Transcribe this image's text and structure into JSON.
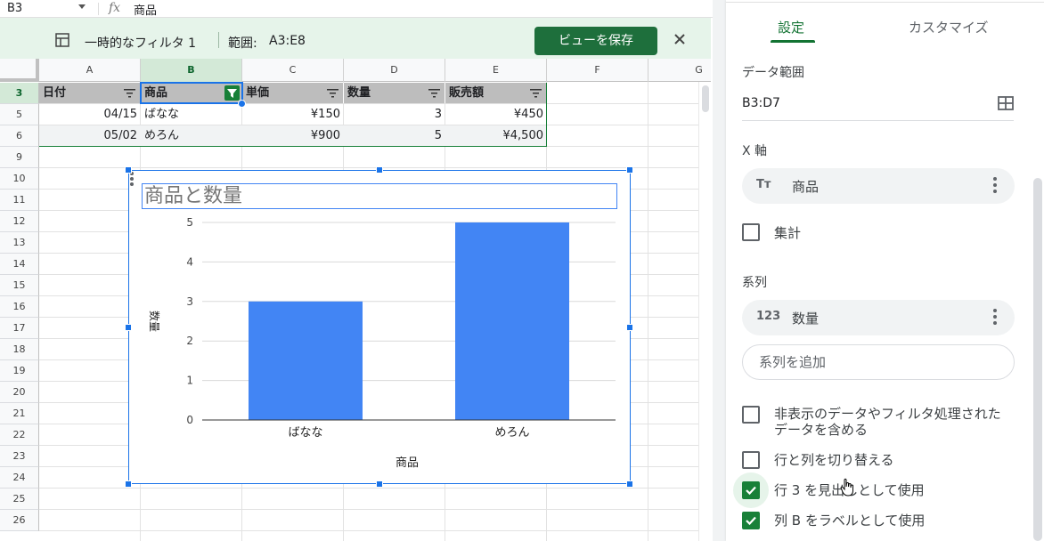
{
  "formula_bar": {
    "cell_ref": "B3",
    "fx": "fx",
    "formula": "商品"
  },
  "filter_view": {
    "name": "一時的なフィルタ 1",
    "range_label": "範囲:",
    "range": "A3:E8",
    "save_button": "ビューを保存"
  },
  "grid": {
    "columns": [
      "A",
      "B",
      "C",
      "D",
      "E",
      "F",
      "G"
    ],
    "rows": [
      "3",
      "5",
      "6",
      "9",
      "10",
      "11",
      "12",
      "13",
      "14",
      "15",
      "16",
      "17",
      "18",
      "19",
      "20",
      "21",
      "22",
      "23",
      "24",
      "25",
      "26"
    ],
    "header_row": [
      "日付",
      "商品",
      "単価",
      "数量",
      "販売額"
    ],
    "data_rows": [
      [
        "04/15",
        "ばなな",
        "¥150",
        "3",
        "¥450"
      ],
      [
        "05/02",
        "めろん",
        "¥900",
        "5",
        "¥4,500"
      ]
    ]
  },
  "chart_data": {
    "type": "bar",
    "title": "商品と数量",
    "categories": [
      "ばなな",
      "めろん"
    ],
    "values": [
      3,
      5
    ],
    "xlabel": "商品",
    "ylabel": "数量",
    "ylim": [
      0,
      5
    ],
    "yticks": [
      "0",
      "1",
      "2",
      "3",
      "4",
      "5"
    ],
    "color": "#4285f4",
    "grid": true,
    "legend": "none"
  },
  "panel": {
    "tabs": [
      "設定",
      "カスタマイズ"
    ],
    "data_range_label": "データ範囲",
    "data_range": "B3:D7",
    "x_axis_label": "X 軸",
    "x_axis_type_icon": "Tт",
    "x_axis_value": "商品",
    "aggregate_label": "集計",
    "series_label": "系列",
    "series_type_icon": "123",
    "series_value": "数量",
    "add_series": "系列を追加",
    "options": [
      {
        "label": "非表示のデータやフィルタ処理された",
        "label2": "データを含める",
        "checked": false
      },
      {
        "label": "行と列を切り替える",
        "checked": false
      },
      {
        "label": "行 3 を見出しとして使用",
        "checked": true
      },
      {
        "label": "列 B をラベルとして使用",
        "checked": true
      }
    ]
  }
}
